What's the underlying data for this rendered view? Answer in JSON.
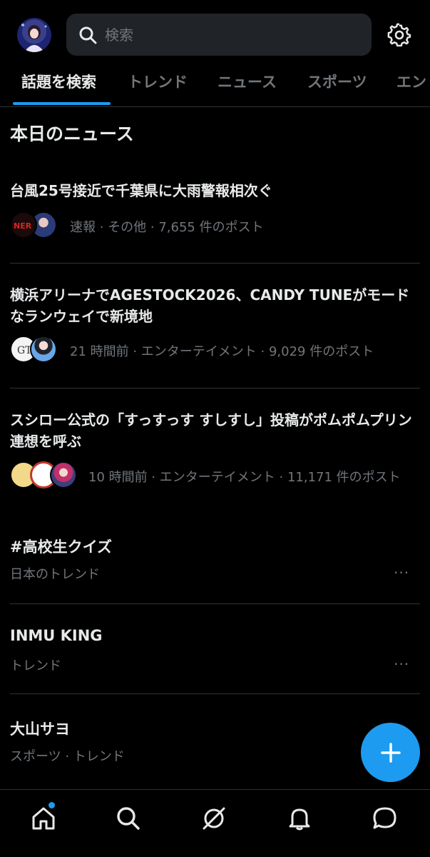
{
  "header": {
    "search_placeholder": "検索"
  },
  "tabs": [
    {
      "label": "話題を検索",
      "active": true
    },
    {
      "label": "トレンド",
      "active": false
    },
    {
      "label": "ニュース",
      "active": false
    },
    {
      "label": "スポーツ",
      "active": false
    },
    {
      "label": "エン",
      "active": false
    }
  ],
  "section_title": "本日のニュース",
  "news": [
    {
      "headline": "台風25号接近で千葉県に大雨警報相次ぐ",
      "meta": "速報 · その他 · 7,655 件のポスト"
    },
    {
      "headline": "横浜アリーナでAGESTOCK2026、CANDY TUNEがモードなランウェイで新境地",
      "meta": "21 時間前 · エンターテイメント · 9,029 件のポスト"
    },
    {
      "headline": "スシロー公式の「すっすっす すしすし」投稿がポムポムプリン連想を呼ぶ",
      "meta": "10 時間前 · エンターテイメント · 11,171 件のポスト"
    }
  ],
  "trends": [
    {
      "title": "#高校生クイズ",
      "sub": "日本のトレンド",
      "more": "···"
    },
    {
      "title": "INMU KING",
      "sub": "トレンド",
      "more": "···"
    },
    {
      "title": "大山サヨ",
      "sub": "スポーツ · トレンド",
      "more": ""
    }
  ],
  "colors": {
    "accent": "#1d9bf0",
    "background": "#000000",
    "text": "#e7e9ea",
    "muted": "#71767b"
  },
  "icons": {
    "home": "home-icon",
    "search": "search-icon",
    "grok": "grok-icon",
    "notifications": "bell-icon",
    "messages": "message-icon",
    "settings": "gear-icon",
    "compose": "plus-icon"
  }
}
